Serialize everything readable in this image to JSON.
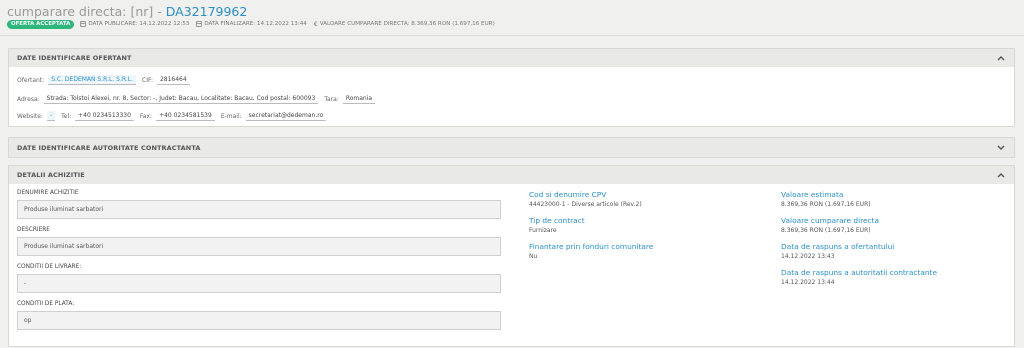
{
  "header": {
    "title_prefix": "cumparare directa: [nr] - ",
    "title_code": "DA32179962",
    "badge": "OFERTA ACCEPTATA",
    "publish": "DATA PUBLICARE: 14.12.2022 12:53",
    "final": "DATA FINALIZARE: 14.12.2022 13:44",
    "value": "VALOARE CUMPARARE DIRECTA: 8.369,36 RON (1.697,16 EUR)"
  },
  "panels": {
    "offerant": {
      "title": "DATE IDENTIFICARE OFERTANT",
      "ofertant_label": "Ofertant:",
      "ofertant_value": "S.C. DEDEMAN S.R.L. S.R.L.",
      "cif_label": "CIF:",
      "cif_value": "2816464",
      "adresa_label": "Adresa:",
      "adresa_value": "Strada: Tolstoi Alexei, nr. 8, Sector: -, Judet: Bacau, Localitate: Bacau, Cod postal: 600093",
      "tara_label": "Tara:",
      "tara_value": "Romania",
      "website_label": "Website:",
      "website_value": "-",
      "tel_label": "Tel:",
      "tel_value": "+40 0234513330",
      "fax_label": "Fax:",
      "fax_value": "+40 0234581539",
      "email_label": "E-mail:",
      "email_value": "secretariat@dedeman.ro"
    },
    "authority": {
      "title": "DATE IDENTIFICARE AUTORITATE CONTRACTANTA"
    },
    "details": {
      "title": "DETALII ACHIZITIE",
      "denumire_label": "DENUMIRE ACHIZITIE",
      "denumire_value": "Produse iluminat sarbatori",
      "descriere_label": "DESCRIERE",
      "descriere_value": "Produse iluminat sarbatori",
      "livrare_label": "CONDITII DE LIVRARE:",
      "livrare_value": "-",
      "plata_label": "CONDITII DE PLATA:",
      "plata_value": "op",
      "cpv_label": "Cod si denumire CPV",
      "cpv_value": "44423000-1 - Diverse articole (Rev.2)",
      "tip_label": "Tip de contract",
      "tip_value": "Furnizare",
      "fonduri_label": "Finantare prin fonduri comunitare",
      "fonduri_value": "Nu",
      "estimata_label": "Valoare estimata",
      "estimata_value": "8.369,36  RON (1.697,16  EUR)",
      "cumparare_label": "Valoare cumparare directa",
      "cumparare_value": "8.369,36  RON (1.697,16  EUR)",
      "raspuns_ofertant_label": "Data de raspuns a ofertantului",
      "raspuns_ofertant_value": "14.12.2022 13:43",
      "raspuns_autoritate_label": "Data de raspuns a autoritatii contractante",
      "raspuns_autoritate_value": "14.12.2022 13:44"
    }
  }
}
